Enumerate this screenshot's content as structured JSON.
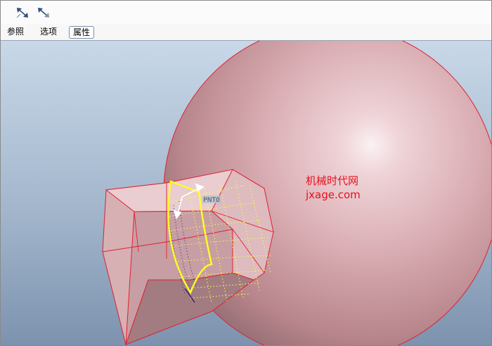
{
  "toolbar": {
    "buttons": [
      {
        "icon": "flip-direction-icon"
      },
      {
        "icon": "flip-direction-alt-icon"
      }
    ]
  },
  "tabs": [
    {
      "label": "参照",
      "active": false
    },
    {
      "label": "选项",
      "active": false
    },
    {
      "label": "属性",
      "active": true
    }
  ],
  "viewport": {
    "feature_tag": "PNT0",
    "watermark": {
      "line1": "机械时代网",
      "line2": "jxage.com"
    },
    "colors": {
      "background_top": "#c6d6e6",
      "background_bottom": "#7f94b0",
      "sphere": "#d4a4aa",
      "edge": "#e02030",
      "preview": "#ffff33"
    }
  }
}
